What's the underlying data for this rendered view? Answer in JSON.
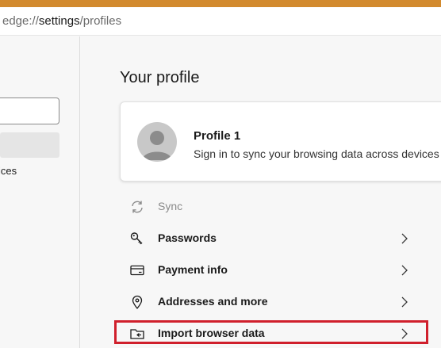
{
  "browser": {
    "url_prefix": "edge://",
    "url_host": "settings",
    "url_path": "/profiles"
  },
  "sidebar": {
    "item_text_fragment": "ices"
  },
  "main": {
    "title": "Your profile",
    "profile": {
      "name": "Profile 1",
      "subtitle": "Sign in to sync your browsing data across devices"
    },
    "menu": [
      {
        "label": "Sync",
        "icon": "sync-icon",
        "disabled": true
      },
      {
        "label": "Passwords",
        "icon": "key-icon",
        "disabled": false
      },
      {
        "label": "Payment info",
        "icon": "credit-card-icon",
        "disabled": false
      },
      {
        "label": "Addresses and more",
        "icon": "location-pin-icon",
        "disabled": false
      },
      {
        "label": "Import browser data",
        "icon": "import-folder-icon",
        "disabled": false
      }
    ]
  },
  "colors": {
    "accent_strip": "#d28a2e",
    "highlight_border": "#d0202c"
  }
}
